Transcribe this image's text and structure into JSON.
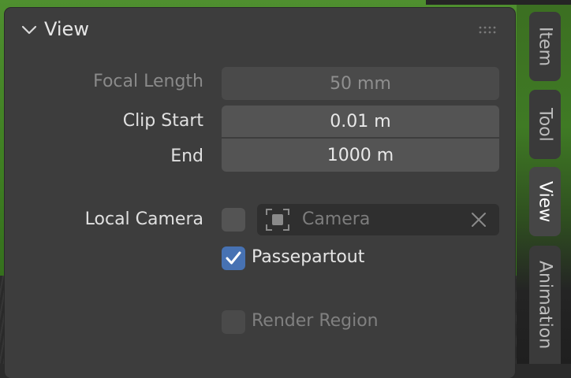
{
  "panel": {
    "title": "View"
  },
  "properties": {
    "focal_length": {
      "label": "Focal Length",
      "value": "50 mm"
    },
    "clip_start": {
      "label": "Clip Start",
      "value": "0.01 m"
    },
    "clip_end": {
      "label": "End",
      "value": "1000 m"
    },
    "local_camera": {
      "label": "Local Camera",
      "checked": false,
      "camera_placeholder": "Camera"
    },
    "passepartout": {
      "label": "Passepartout",
      "checked": true
    },
    "render_region": {
      "label": "Render Region",
      "checked": false
    }
  },
  "tabs": [
    {
      "label": "Item",
      "active": false
    },
    {
      "label": "Tool",
      "active": false
    },
    {
      "label": "View",
      "active": true
    },
    {
      "label": "Animation",
      "active": false
    }
  ],
  "colors": {
    "panel_bg": "#3d3d3d",
    "field_bg": "#545454",
    "checkbox_checked": "#4772b3",
    "viewport_grid": "#4f8f2f"
  },
  "icons": {
    "collapse": "chevron-down-icon",
    "grip": "drag-grip-icon",
    "camera": "object-data-icon",
    "clear": "close-icon",
    "check": "checkmark-icon"
  }
}
